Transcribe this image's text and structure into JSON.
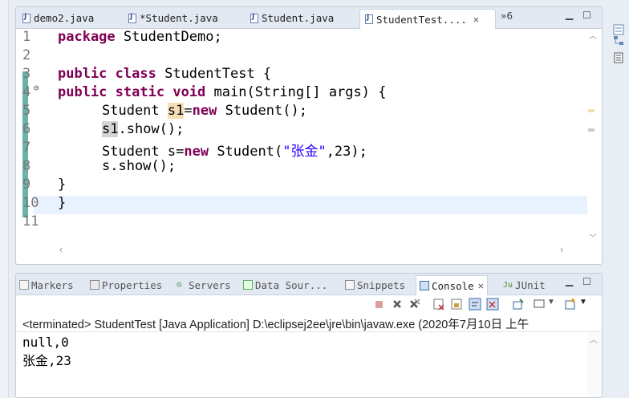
{
  "editor": {
    "tabs": [
      {
        "label": "demo2.java",
        "active": false
      },
      {
        "label": "*Student.java",
        "active": false
      },
      {
        "label": "Student.java",
        "active": false
      },
      {
        "label": "StudentTest....",
        "active": true
      }
    ],
    "overflow_label": "»6",
    "code_lines": [
      {
        "n": "1"
      },
      {
        "n": "2"
      },
      {
        "n": "3"
      },
      {
        "n": "4"
      },
      {
        "n": "5"
      },
      {
        "n": "6"
      },
      {
        "n": "7"
      },
      {
        "n": "8"
      },
      {
        "n": "9"
      },
      {
        "n": "10"
      },
      {
        "n": "11"
      }
    ],
    "code": {
      "l1_kw": "package",
      "l1_rest": " StudentDemo;",
      "l3_kw1": "public",
      "l3_kw2": "class",
      "l3_rest": " StudentTest {",
      "l4_kw1": "public",
      "l4_kw2": "static",
      "l4_kw3": "void",
      "l4_rest": " main(String[] args) {",
      "l5_a": "Student ",
      "l5_var": "s1",
      "l5_eq": "=",
      "l5_kw": "new",
      "l5_rest": " Student();",
      "l6_var": "s1",
      "l6_rest": ".show();",
      "l7_a": "Student s=",
      "l7_kw": "new",
      "l7_b": " Student(",
      "l7_str": "\"张金\"",
      "l7_rest": ",23);",
      "l8": "s.show();",
      "l9": "}",
      "l10": "}"
    }
  },
  "console": {
    "tabs": [
      {
        "label": "Markers"
      },
      {
        "label": "Properties"
      },
      {
        "label": "Servers"
      },
      {
        "label": "Data Sour..."
      },
      {
        "label": "Snippets"
      },
      {
        "label": "Console"
      },
      {
        "label": "JUnit"
      }
    ],
    "junit_prefix": "Ju",
    "status": "<terminated> StudentTest [Java Application] D:\\eclipsej2ee\\jre\\bin\\javaw.exe (2020年7月10日 上午",
    "output": [
      "null,0",
      "张金,23"
    ]
  },
  "colors": {
    "keyword": "#7f0055",
    "string": "#2a00ff",
    "line_number": "#787878",
    "diff_marker": "#6bb3a6"
  }
}
